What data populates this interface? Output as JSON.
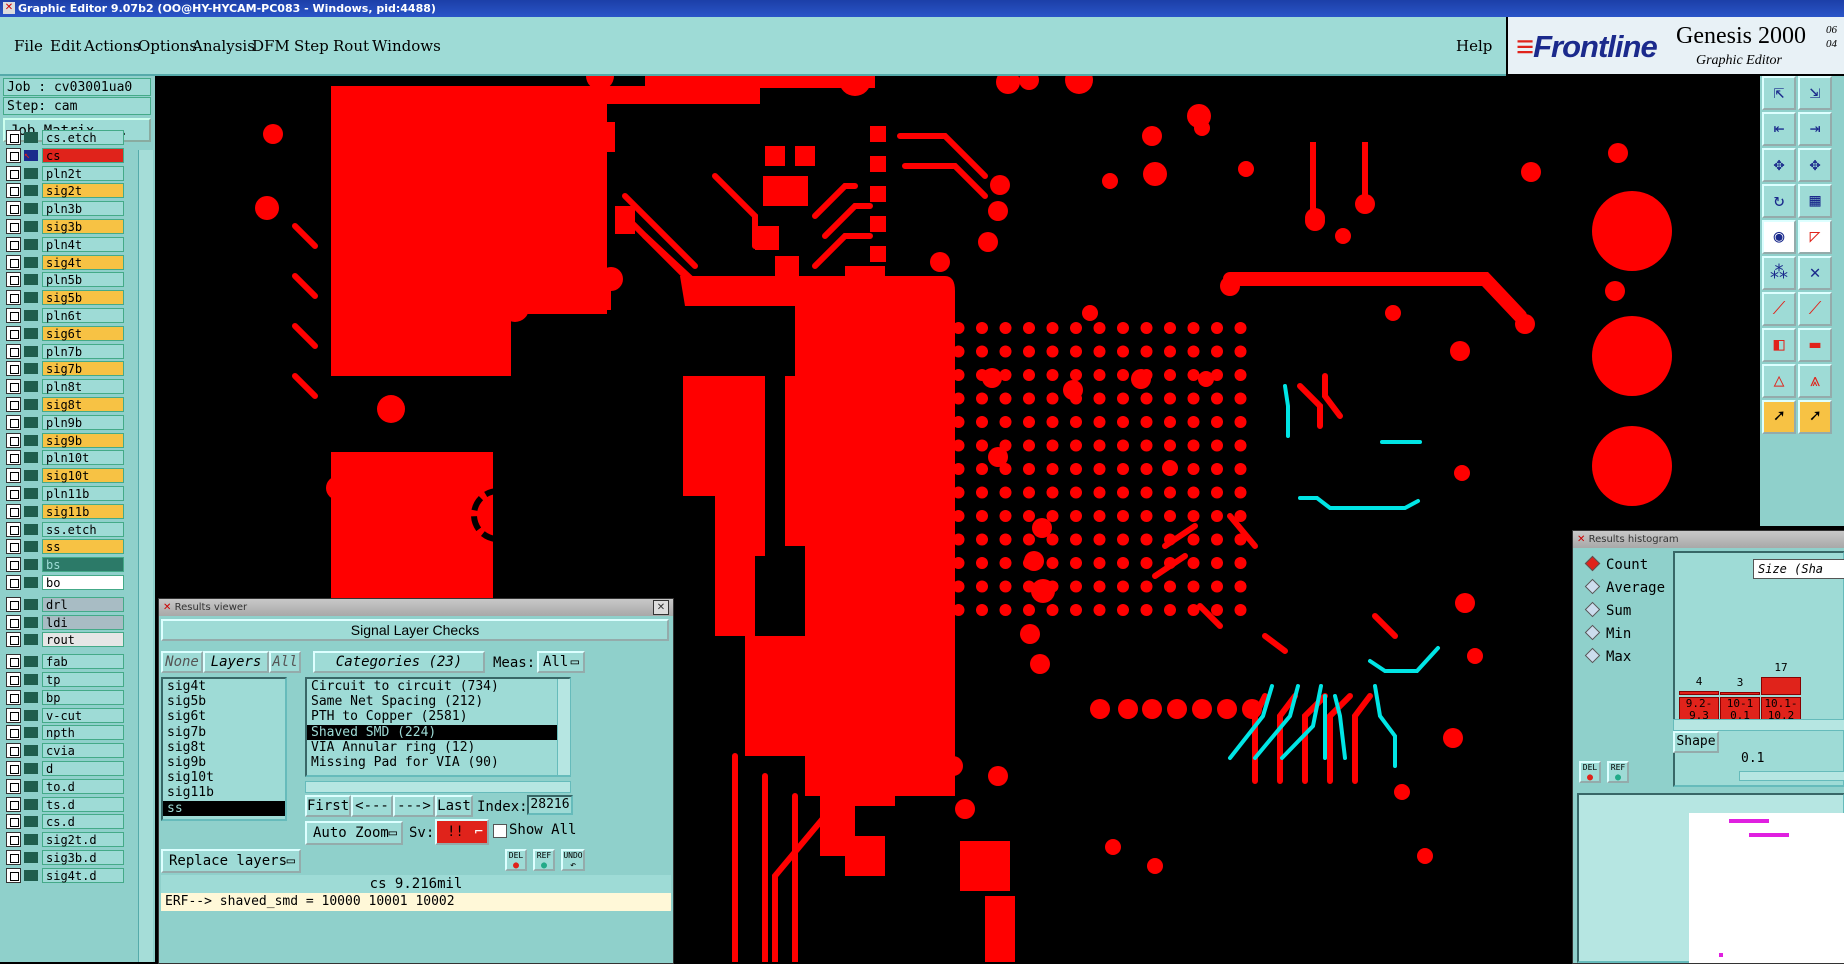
{
  "title_bar": "Graphic Editor 9.07b2 (OO@HY-HYCAM-PC083 - Windows, pid:4488)",
  "menu": {
    "items": [
      "File",
      "Edit",
      "Actions",
      "Options",
      "Analysis",
      "DFM",
      "Step",
      "Rout",
      "Windows"
    ],
    "help": "Help"
  },
  "brand": {
    "logo_main": "Frontline",
    "product": "Genesis 2000",
    "version_fragment": "06 04",
    "subtitle": "Graphic Editor"
  },
  "job": {
    "job_label": "Job : cv03001ua0",
    "step_label": "Step: cam",
    "job_matrix_button": "Job Matrix ..."
  },
  "layers": [
    {
      "name": "cs.etch",
      "color": "#9edbd6"
    },
    {
      "name": "cs",
      "color": "#e0231b",
      "active": true
    },
    {
      "name": "pln2t",
      "color": "#9edbd6"
    },
    {
      "name": "sig2t",
      "color": "#f7c244"
    },
    {
      "name": "pln3b",
      "color": "#9edbd6"
    },
    {
      "name": "sig3b",
      "color": "#f7c244"
    },
    {
      "name": "pln4t",
      "color": "#9edbd6"
    },
    {
      "name": "sig4t",
      "color": "#f7c244"
    },
    {
      "name": "pln5b",
      "color": "#9edbd6"
    },
    {
      "name": "sig5b",
      "color": "#f7c244"
    },
    {
      "name": "pln6t",
      "color": "#9edbd6"
    },
    {
      "name": "sig6t",
      "color": "#f7c244"
    },
    {
      "name": "pln7b",
      "color": "#9edbd6"
    },
    {
      "name": "sig7b",
      "color": "#f7c244"
    },
    {
      "name": "pln8t",
      "color": "#9edbd6"
    },
    {
      "name": "sig8t",
      "color": "#f7c244"
    },
    {
      "name": "pln9b",
      "color": "#9edbd6"
    },
    {
      "name": "sig9b",
      "color": "#f7c244"
    },
    {
      "name": "pln10t",
      "color": "#9edbd6"
    },
    {
      "name": "sig10t",
      "color": "#f7c244"
    },
    {
      "name": "pln11b",
      "color": "#9edbd6"
    },
    {
      "name": "sig11b",
      "color": "#f7c244"
    },
    {
      "name": "ss.etch",
      "color": "#9edbd6"
    },
    {
      "name": "ss",
      "color": "#f7c244"
    },
    {
      "name": "bs",
      "color": "#2c7a68"
    },
    {
      "name": "bo",
      "color": "#ffffff"
    },
    {
      "name": "drl",
      "color": "#a8bcc4"
    },
    {
      "name": "ldi",
      "color": "#a8bcc4"
    },
    {
      "name": "rout",
      "color": "#e6e6e6"
    },
    {
      "name": "fab",
      "color": "#9edbd6"
    },
    {
      "name": "tp",
      "color": "#9edbd6"
    },
    {
      "name": "bp",
      "color": "#9edbd6"
    },
    {
      "name": "v-cut",
      "color": "#9edbd6"
    },
    {
      "name": "npth",
      "color": "#9edbd6"
    },
    {
      "name": "cvia",
      "color": "#9edbd6"
    },
    {
      "name": "d",
      "color": "#9edbd6"
    },
    {
      "name": "to.d",
      "color": "#9edbd6"
    },
    {
      "name": "ts.d",
      "color": "#9edbd6"
    },
    {
      "name": "cs.d",
      "color": "#9edbd6"
    },
    {
      "name": "sig2t.d",
      "color": "#9edbd6"
    },
    {
      "name": "sig3b.d",
      "color": "#9edbd6"
    },
    {
      "name": "sig4t.d",
      "color": "#9edbd6"
    }
  ],
  "results_viewer": {
    "title": "Results viewer",
    "header": "Signal Layer Checks",
    "none_btn": "None",
    "layers_btn": "Layers",
    "all_btn": "All",
    "categories_btn": "Categories (23)",
    "meas_label": "Meas:",
    "meas_value": "All",
    "layer_list": [
      "sig4t",
      "sig5b",
      "sig6t",
      "sig7b",
      "sig8t",
      "sig9b",
      "sig10t",
      "sig11b",
      "ss"
    ],
    "selected_layer": "ss",
    "categories": [
      "Circuit to circuit (734)",
      "Same Net Spacing (212)",
      "PTH to Copper (2581)",
      "Shaved SMD (224)",
      "VIA Annular ring (12)",
      "Missing Pad for VIA (90)"
    ],
    "selected_category": "Shaved SMD (224)",
    "first_btn": "First",
    "prev_btn": "<---",
    "next_btn": "--->",
    "last_btn": "Last",
    "index_label": "Index:",
    "index_value": "28216",
    "auto_zoom_btn": "Auto Zoom",
    "sv_label": "Sv:",
    "sv_value": "!!",
    "show_all_label": "Show All",
    "replace_layers_btn": "Replace layers",
    "del_btn": "DEL",
    "ref_btn": "REF",
    "undo_btn": "UNDO",
    "status": "cs 9.216mil",
    "erf_line": "ERF--> shaved_smd = 10000 10001 10002"
  },
  "histogram": {
    "title": "Results histogram",
    "options": [
      "Count",
      "Average",
      "Sum",
      "Min",
      "Max"
    ],
    "selected_option": "Count",
    "size_label": "Size (Sha",
    "bars": [
      {
        "label": "9.2-9.3",
        "value": 4
      },
      {
        "label": "10-10.1",
        "value": 3
      },
      {
        "label": "10.1-10.2",
        "value": 17
      }
    ],
    "shape_btn": "Shape",
    "slider_value": "0.1",
    "del_btn": "DEL",
    "ref_btn": "REF"
  }
}
